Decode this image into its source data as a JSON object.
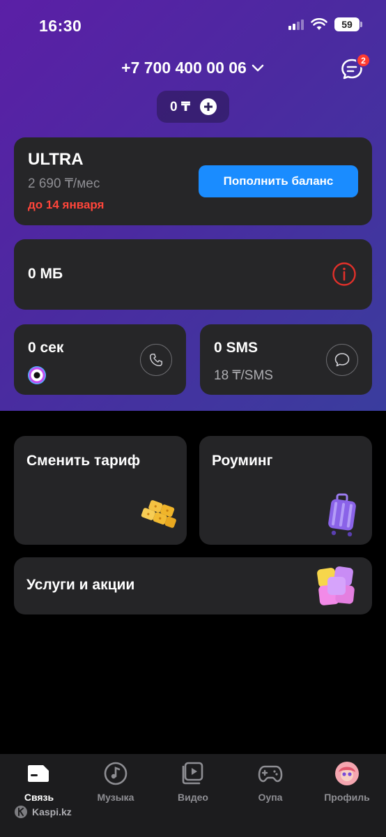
{
  "status_bar": {
    "time": "16:30",
    "battery": "59"
  },
  "header": {
    "phone_number": "+7 700 400 00 06",
    "notification_count": "2"
  },
  "balance": {
    "amount": "0 ₸"
  },
  "tariff": {
    "name": "ULTRA",
    "price": "2 690 ₸/мес",
    "valid_until": "до 14 января",
    "topup_label": "Пополнить баланс"
  },
  "data": {
    "value": "0 МБ"
  },
  "calls": {
    "value": "0 сек"
  },
  "sms": {
    "value": "0 SMS",
    "price": "18 ₸/SMS"
  },
  "tiles": {
    "change_tariff": "Сменить тариф",
    "roaming": "Роуминг",
    "services": "Услуги и акции"
  },
  "nav": {
    "items": [
      {
        "label": "Связь",
        "icon": "sim-icon",
        "active": true
      },
      {
        "label": "Музыка",
        "icon": "music-icon"
      },
      {
        "label": "Видео",
        "icon": "video-icon"
      },
      {
        "label": "Оупа",
        "icon": "gamepad-icon"
      },
      {
        "label": "Профиль",
        "icon": "avatar-icon"
      }
    ]
  },
  "watermark": "Kaspi.kz",
  "colors": {
    "accent_blue": "#1a8cff",
    "alert_red": "#ff453a",
    "gradient_start": "#5b1fa6",
    "gradient_end": "#3a3d9e"
  }
}
